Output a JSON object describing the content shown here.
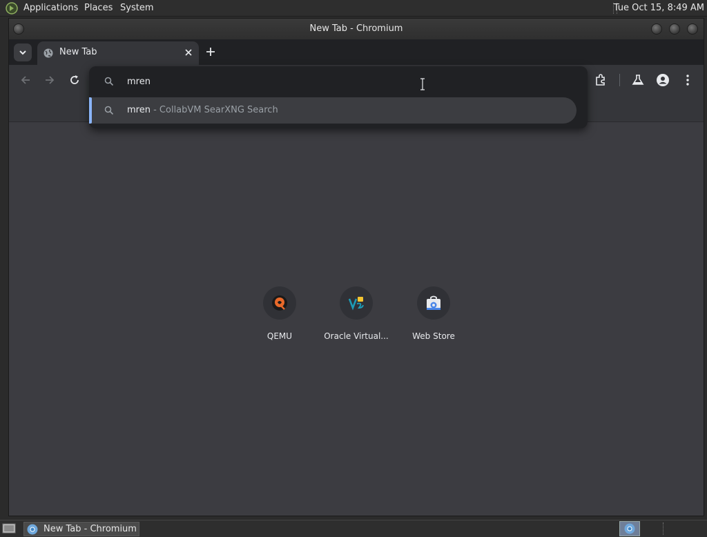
{
  "top_panel": {
    "menus": [
      "Applications",
      "Places",
      "System"
    ],
    "clock": "Tue Oct 15,  8:49 AM"
  },
  "window": {
    "title": "New Tab - Chromium"
  },
  "tabstrip": {
    "tab_title": "New Tab"
  },
  "omnibox": {
    "input_value": "mren",
    "suggestion_query": "mren",
    "suggestion_desc": " - CollabVM SearXNG Search"
  },
  "shortcuts": [
    {
      "label": "QEMU",
      "icon": "qemu-icon"
    },
    {
      "label": "Oracle Virtual...",
      "icon": "virtualbox-icon"
    },
    {
      "label": "Web Store",
      "icon": "webstore-icon"
    }
  ],
  "taskbar": {
    "task_label": "New Tab - Chromium"
  },
  "colors": {
    "accent": "#8ab4f8",
    "page_bg": "#3c3c41",
    "toolbar_bg": "#35363a",
    "omnibox_bg": "#202124"
  }
}
